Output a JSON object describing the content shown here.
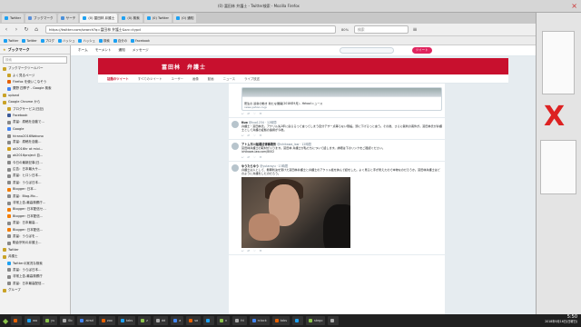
{
  "window": {
    "title": "(0) 冨田林 弁護士 - Twitter検索 - Mozilla Firefox"
  },
  "tabs": [
    {
      "label": "Twitter",
      "color": "#1da1f2",
      "active": false
    },
    {
      "label": "ブックマーク",
      "color": "#5a8fd8",
      "active": false
    },
    {
      "label": "サーチ",
      "color": "#4a90d9",
      "active": false
    },
    {
      "label": "(0) 冨田林 弁護士",
      "color": "#1da1f2",
      "active": true
    },
    {
      "label": "(0) 検索",
      "color": "#1da1f2",
      "active": false
    },
    {
      "label": "(0) Twitter",
      "color": "#1da1f2",
      "active": false
    },
    {
      "label": "(0) 通知",
      "color": "#1da1f2",
      "active": false
    }
  ],
  "nav": {
    "url": "https://twitter.com/search?q=冨田林 弁護士&src=typd",
    "zoom": "80%",
    "search_placeholder": "検索"
  },
  "bookmarks_toolbar": [
    "Twitter",
    "Twitter",
    "ブログ",
    "ハッシュ",
    "ハッシュ",
    "検索",
    "自分の",
    "Facebook"
  ],
  "sidebar": {
    "title": "ブックマーク",
    "search_placeholder": "検索",
    "items": [
      {
        "label": "ブックマークツールバー",
        "icon": "folder-icon",
        "color": "#c9a227"
      },
      {
        "label": "よく見るページ",
        "icon": "folder-icon",
        "color": "#c9a227"
      },
      {
        "label": "Firefox を使いこなそう",
        "icon": "firefox-icon",
        "color": "#e66000"
      },
      {
        "label": "廣野 四季子 - Google 検索",
        "icon": "google-icon",
        "color": "#4285f4"
      },
      {
        "label": "upload",
        "icon": "folder-icon",
        "color": "#c9a227"
      },
      {
        "label": "Google Chrome から",
        "icon": "folder-icon",
        "color": "#c9a227"
      },
      {
        "label": "ブログサービス(日記)",
        "icon": "folder-icon",
        "color": "#c9a227"
      },
      {
        "label": "Facebook",
        "icon": "facebook-icon",
        "color": "#3b5998"
      },
      {
        "label": "書留：原稿を自動で…",
        "icon": "page-icon",
        "color": "#888888"
      },
      {
        "label": "Google",
        "icon": "google-icon",
        "color": "#4285f4"
      },
      {
        "label": "hirano2016Wakono",
        "icon": "page-icon",
        "color": "#888888"
      },
      {
        "label": "書留：原稿を自動…",
        "icon": "page-icon",
        "color": "#888888"
      },
      {
        "label": "ak2016hr at mixi…",
        "icon": "mixi-icon",
        "color": "#d4a017"
      },
      {
        "label": "ak2016project 自…",
        "icon": "page-icon",
        "color": "#888888"
      },
      {
        "label": "今日の最新記事(日…",
        "icon": "page-icon",
        "color": "#888888"
      },
      {
        "label": "広告：日本最大サ…",
        "icon": "page-icon",
        "color": "#888888"
      },
      {
        "label": "書留：ヒロシ日本…",
        "icon": "page-icon",
        "color": "#888888"
      },
      {
        "label": "書留：うらば日本…",
        "icon": "page-icon",
        "color": "#888888"
      },
      {
        "label": "Blogger: 日本…",
        "icon": "blogger-icon",
        "color": "#f57d00"
      },
      {
        "label": "書留：Blog-Mo…",
        "icon": "page-icon",
        "color": "#888888"
      },
      {
        "label": "非常上告-最高検察庁…",
        "icon": "page-icon",
        "color": "#888888"
      },
      {
        "label": "Blogger: 日本配信セ…",
        "icon": "blogger-icon",
        "color": "#f57d00"
      },
      {
        "label": "Blogger: 日本配信…",
        "icon": "blogger-icon",
        "color": "#f57d00"
      },
      {
        "label": "書留：日本最高…",
        "icon": "page-icon",
        "color": "#888888"
      },
      {
        "label": "Blogger: 日本配信…",
        "icon": "blogger-icon",
        "color": "#f57d00"
      },
      {
        "label": "書留：うらばを…",
        "icon": "page-icon",
        "color": "#888888"
      },
      {
        "label": "駒倉宗利の弁護士…",
        "icon": "page-icon",
        "color": "#888888"
      },
      {
        "label": "Twitter",
        "icon": "folder-icon",
        "color": "#c9a227"
      },
      {
        "label": "弁護士",
        "icon": "folder-icon",
        "color": "#c9a227"
      },
      {
        "label": "Twitterの実況な検索",
        "icon": "twitter-icon",
        "color": "#1da1f2"
      },
      {
        "label": "書留：うらば日本…",
        "icon": "page-icon",
        "color": "#888888"
      },
      {
        "label": "非常上告-最高検察庁",
        "icon": "page-icon",
        "color": "#888888"
      },
      {
        "label": "書留：日本最高配信…",
        "icon": "page-icon",
        "color": "#888888"
      },
      {
        "label": "グループ",
        "icon": "folder-icon",
        "color": "#c9a227"
      }
    ]
  },
  "twitter": {
    "nav": [
      "ホーム",
      "モーメント",
      "通知",
      "メッセージ"
    ],
    "tweet_button": "ツイート",
    "search_header": "冨田林　弁護士",
    "filters": [
      "話題のツイート",
      "すべてのツイート",
      "ユーザー",
      "画像",
      "動画",
      "ニュース",
      "ライブ放送"
    ],
    "tweets": [
      {
        "name": "",
        "handle": "",
        "time": "",
        "text": "",
        "card_title": "更生の 最新の動き 新たな展開(2018年9月) - Yahoo!ニュース",
        "card_domain": "news.yahoo.co.jp"
      },
      {
        "name": "Kuo",
        "handle": "@kuo1234",
        "time": "12時間",
        "text": "弁護士・冨田林氏。アクリル先1年に戻らるって言ってしまう自分デザー点等らない限設。頭に下げるっと言う。その後、さらに裁判の案件が。冨田林氏が弁護士として弁護の証拠の連携が今後。",
        "card_title": "",
        "card_domain": ""
      },
      {
        "name": "アトム市川船橋法律事務所",
        "handle": "@ichikawa_law",
        "time": "12時間",
        "text": "冨田林弁護士の取材が入ります。冨田林 弁護士が私たちについて話します。詳細は下のリンクをご確認ください。",
        "card_title": "",
        "card_domain": "",
        "link": "ichikawa-law.com/8002"
      },
      {
        "name": "ゆうたらゆう",
        "handle": "@yutarayu",
        "time": "13時間",
        "text": "弁護士は人として、無罪判決を受けた冨田林弁護士と弁護士のアクリル板を挟んで話をした。よく見ると手が見えたので本物なのだろうか。冨田林弁護士はどのように弁護をしたのだろう。",
        "card_title": "",
        "card_domain": "",
        "has_photo": true
      }
    ]
  },
  "taskbar": {
    "items": [
      "",
      "wa",
      "yu",
      "0b",
      "airsd",
      "zoo",
      "tabs",
      "z",
      "dd",
      "a",
      "sa",
      "",
      "n",
      "fd",
      "rclock",
      "tabs",
      "",
      "stego",
      ""
    ],
    "time": "5:50",
    "date": "2018年9月16日(日曜日)"
  }
}
